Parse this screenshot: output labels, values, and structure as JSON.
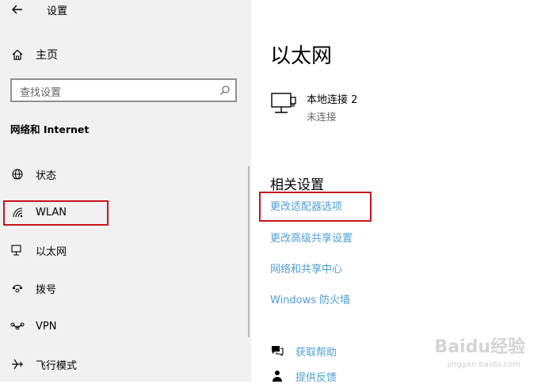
{
  "window": {
    "title": "设置"
  },
  "sidebar": {
    "home_label": "主页",
    "search_placeholder": "查找设置",
    "section_title": "网络和 Internet",
    "items": [
      {
        "label": "状态",
        "icon": "globe-icon"
      },
      {
        "label": "WLAN",
        "icon": "wifi-icon"
      },
      {
        "label": "以太网",
        "icon": "ethernet-icon"
      },
      {
        "label": "拨号",
        "icon": "dialup-icon"
      },
      {
        "label": "VPN",
        "icon": "vpn-icon"
      },
      {
        "label": "飞行模式",
        "icon": "airplane-icon"
      }
    ]
  },
  "main": {
    "title": "以太网",
    "connection": {
      "name": "本地连接 2",
      "status": "未连接"
    },
    "related_title": "相关设置",
    "links": [
      "更改适配器选项",
      "更改高级共享设置",
      "网络和共享中心",
      "Windows 防火墙"
    ],
    "help": [
      {
        "label": "获取帮助",
        "icon": "help-chat-icon"
      },
      {
        "label": "提供反馈",
        "icon": "feedback-icon"
      }
    ]
  },
  "watermark": {
    "text": "Baidu经验",
    "sub": "jingyan.baidu.com"
  },
  "colors": {
    "sidebar_bg": "#f1f1f1",
    "link": "#4d9ed6",
    "highlight": "#c8151e"
  }
}
